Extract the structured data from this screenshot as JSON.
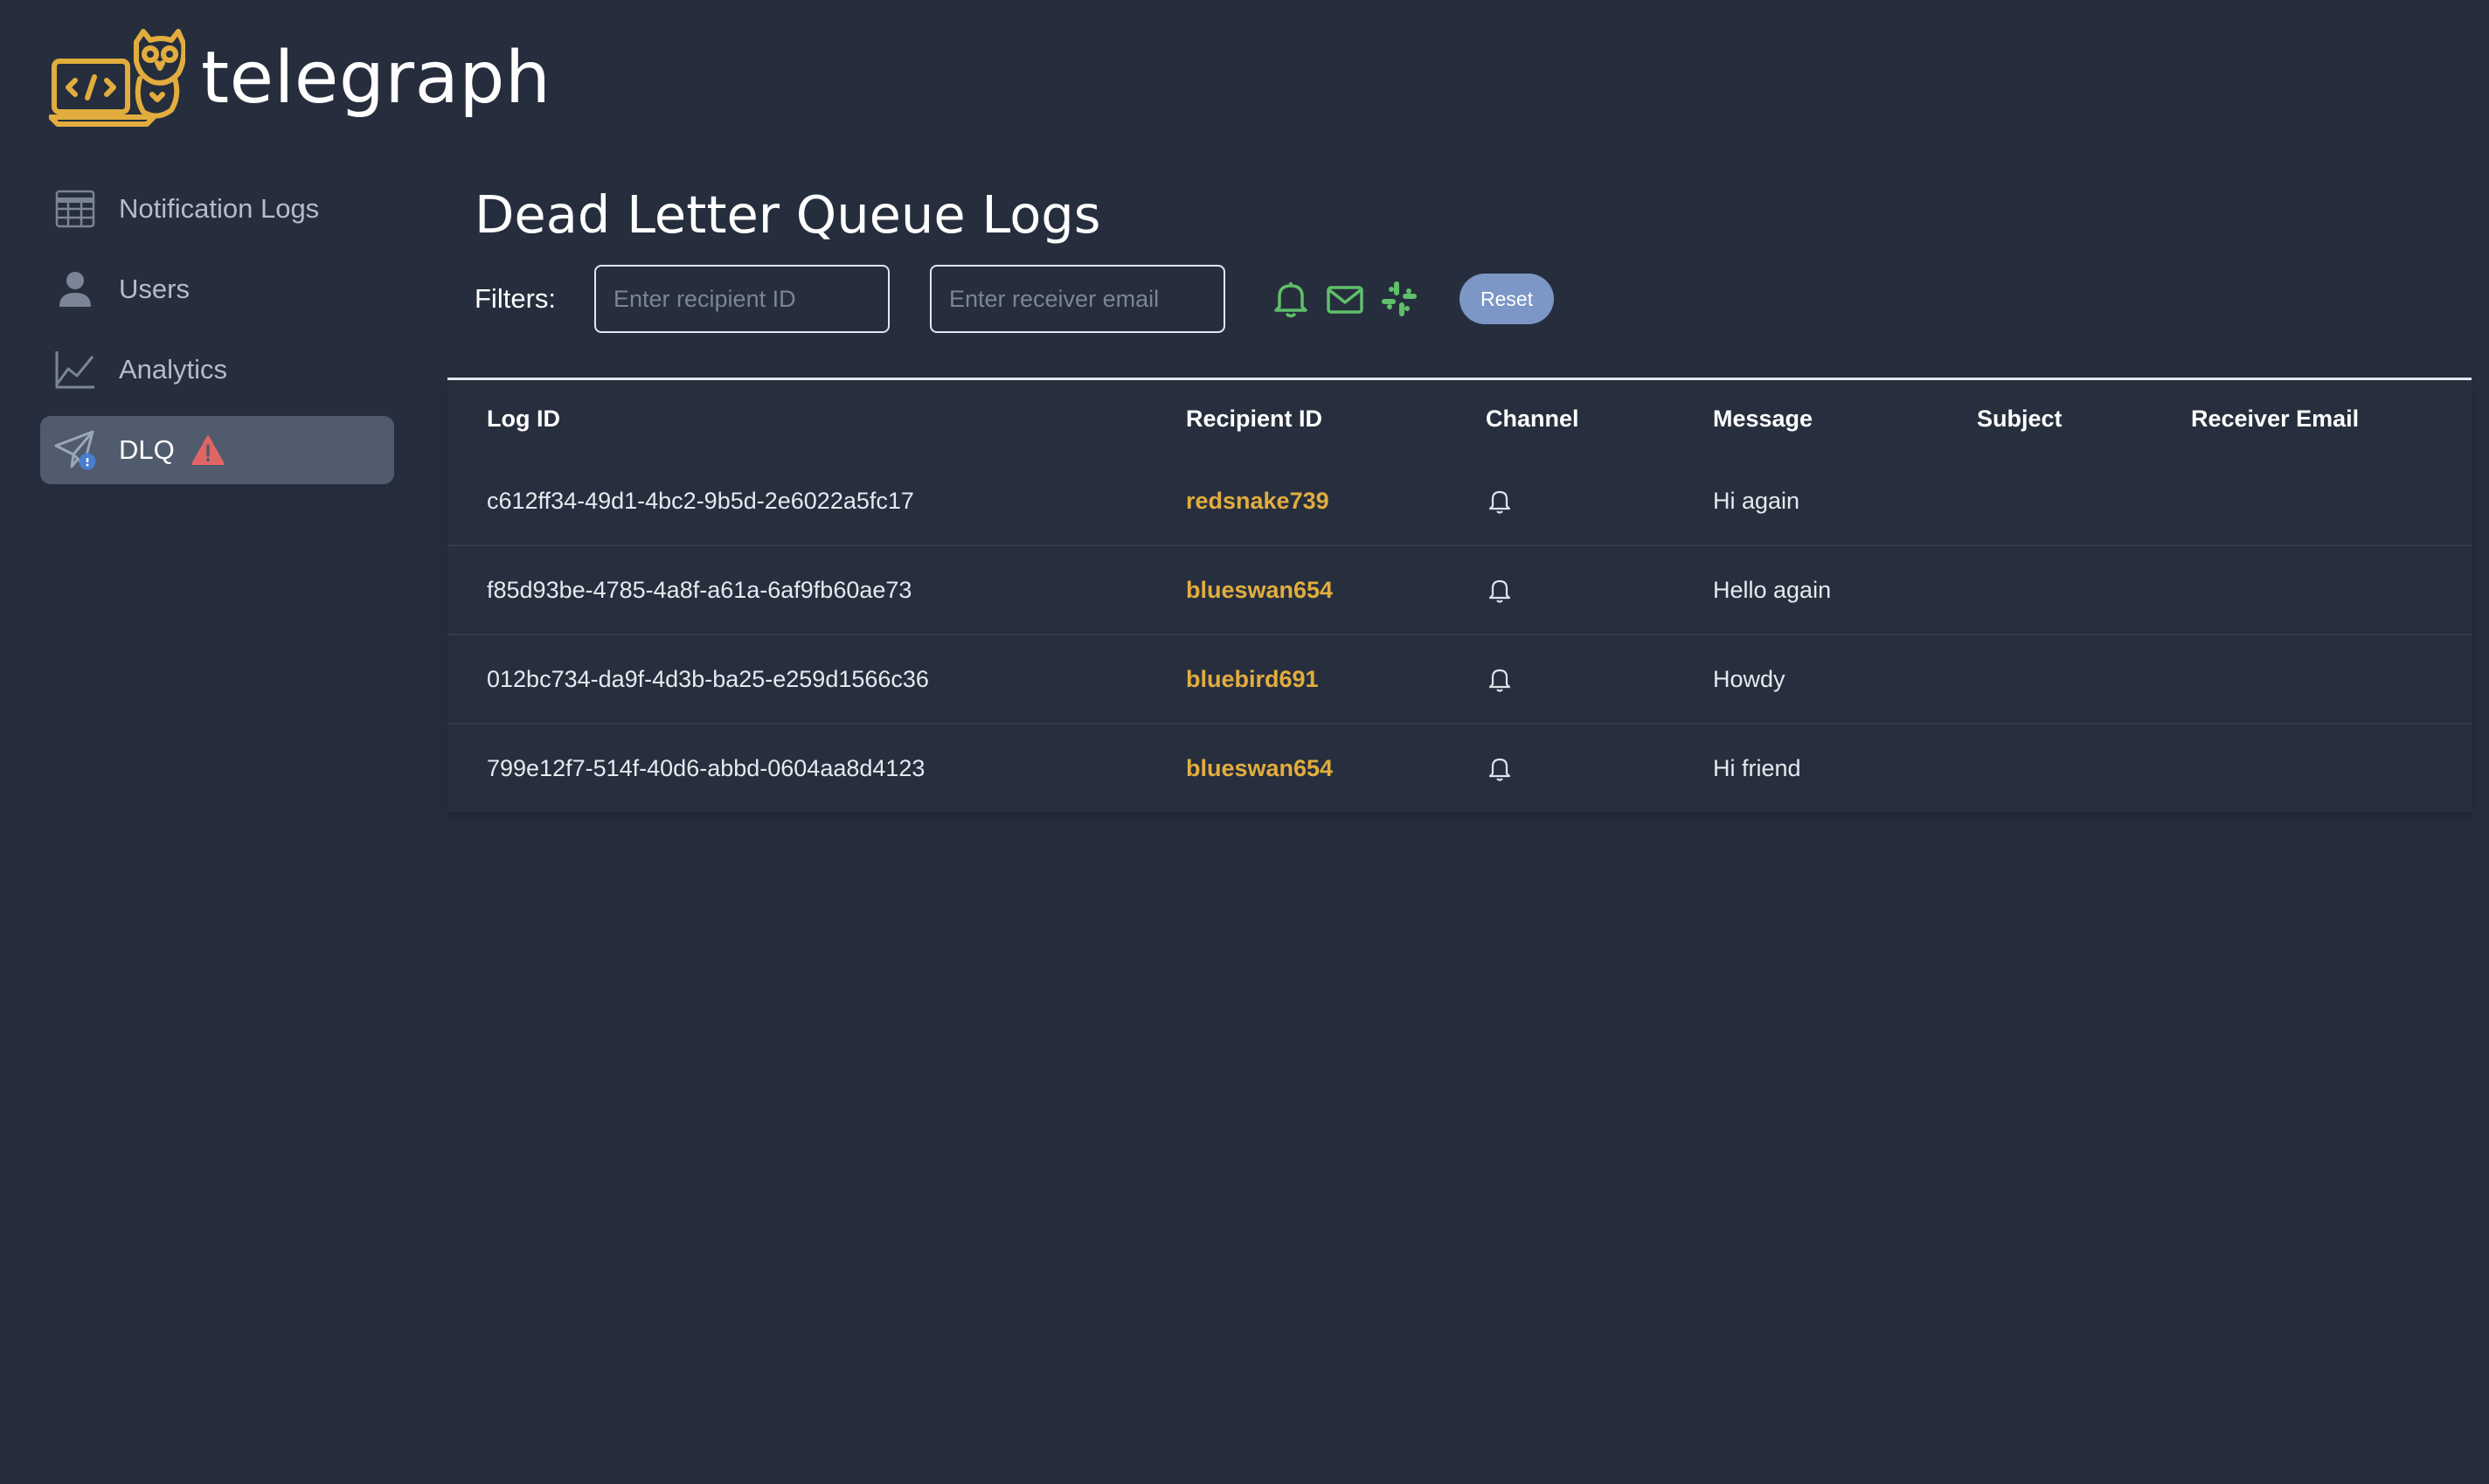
{
  "brand": {
    "name": "telegraph",
    "logo_icon": "owl-laptop-logo"
  },
  "sidebar": {
    "items": [
      {
        "label": "Notification Logs",
        "icon": "table-grid-icon",
        "active": false
      },
      {
        "label": "Users",
        "icon": "user-icon",
        "active": false
      },
      {
        "label": "Analytics",
        "icon": "line-chart-icon",
        "active": false
      },
      {
        "label": "DLQ",
        "icon": "paper-plane-alert-icon",
        "active": true,
        "badge_icon": "warning-triangle-icon"
      }
    ]
  },
  "main": {
    "title": "Dead Letter Queue Logs",
    "filters": {
      "label": "Filters:",
      "recipient_placeholder": "Enter recipient ID",
      "recipient_value": "",
      "email_placeholder": "Enter receiver email",
      "email_value": "",
      "channel_icons": [
        "bell-icon",
        "mail-icon",
        "slack-icon"
      ],
      "reset_label": "Reset"
    },
    "table": {
      "columns": [
        "Log ID",
        "Recipient ID",
        "Channel",
        "Message",
        "Subject",
        "Receiver Email"
      ],
      "rows": [
        {
          "log_id": "c612ff34-49d1-4bc2-9b5d-2e6022a5fc17",
          "recipient_id": "redsnake739",
          "channel": "bell-icon",
          "message": "Hi again",
          "subject": "",
          "receiver_email": ""
        },
        {
          "log_id": "f85d93be-4785-4a8f-a61a-6af9fb60ae73",
          "recipient_id": "blueswan654",
          "channel": "bell-icon",
          "message": "Hello again",
          "subject": "",
          "receiver_email": ""
        },
        {
          "log_id": "012bc734-da9f-4d3b-ba25-e259d1566c36",
          "recipient_id": "bluebird691",
          "channel": "bell-icon",
          "message": "Howdy",
          "subject": "",
          "receiver_email": ""
        },
        {
          "log_id": "799e12f7-514f-40d6-abbd-0604aa8d4123",
          "recipient_id": "blueswan654",
          "channel": "bell-icon",
          "message": "Hi friend",
          "subject": "",
          "receiver_email": ""
        }
      ]
    }
  },
  "colors": {
    "background": "#262e3d",
    "accent_gold": "#e2ad3e",
    "channel_green": "#5fbf6a",
    "active_nav": "#505b6e",
    "reset_button": "#7c96c6",
    "warning_red": "#e06666"
  }
}
